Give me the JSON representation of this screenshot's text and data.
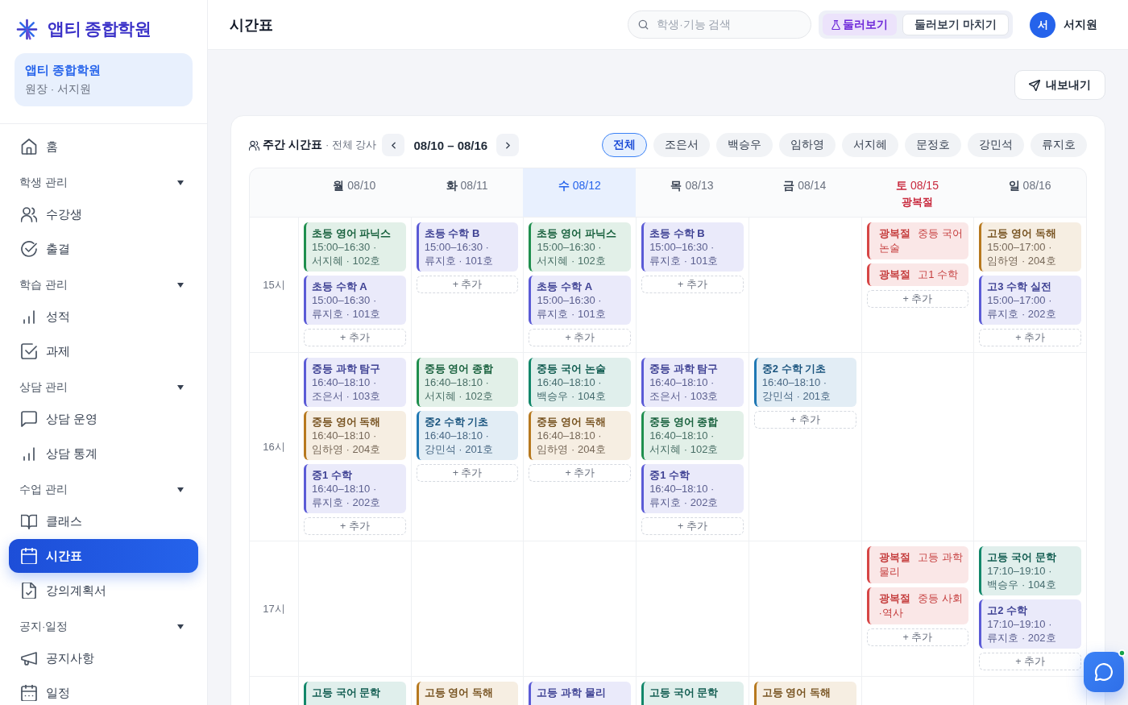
{
  "brand": {
    "name": "앱티 종합학원"
  },
  "org": {
    "name": "앱티 종합학원",
    "role": "원장 · 서지원"
  },
  "sidebar": {
    "items": [
      {
        "kind": "item",
        "label": "홈",
        "selected": false
      },
      {
        "kind": "group",
        "label": "학생 관리",
        "expanded": true,
        "children": [
          {
            "label": "수강생",
            "selected": false
          },
          {
            "label": "출결",
            "selected": false
          }
        ]
      },
      {
        "kind": "group",
        "label": "학습 관리",
        "expanded": true,
        "children": [
          {
            "label": "성적",
            "selected": false
          },
          {
            "label": "과제",
            "selected": false
          }
        ]
      },
      {
        "kind": "group",
        "label": "상담 관리",
        "expanded": true,
        "children": [
          {
            "label": "상담 운영",
            "selected": false
          },
          {
            "label": "상담 통계",
            "selected": false
          }
        ]
      },
      {
        "kind": "group",
        "label": "수업 관리",
        "expanded": true,
        "children": [
          {
            "label": "클래스",
            "selected": false
          },
          {
            "label": "시간표",
            "selected": true
          },
          {
            "label": "강의계획서",
            "selected": false
          }
        ]
      },
      {
        "kind": "group",
        "label": "공지·일정",
        "expanded": true,
        "children": [
          {
            "label": "공지사항",
            "selected": false
          },
          {
            "label": "일정",
            "selected": false
          }
        ]
      }
    ]
  },
  "topbar": {
    "title": "시간표",
    "search": {
      "placeholder": "학생·기능 검색"
    },
    "tour_button": "둘러보기",
    "tour_end_button": "둘러보기 마치기",
    "user": {
      "initial": "서",
      "name": "서지원"
    }
  },
  "export_button": "내보내기",
  "timetable": {
    "title": "주간 시간표",
    "scope": "· 전체 강사",
    "range": "08/10 – 08/16",
    "filters": [
      {
        "label": "전체",
        "selected": true
      },
      {
        "label": "조은서",
        "selected": false
      },
      {
        "label": "백승우",
        "selected": false
      },
      {
        "label": "임하영",
        "selected": false
      },
      {
        "label": "서지혜",
        "selected": false
      },
      {
        "label": "문정호",
        "selected": false
      },
      {
        "label": "강민석",
        "selected": false
      },
      {
        "label": "류지호",
        "selected": false
      }
    ],
    "days": [
      {
        "weekday": "월",
        "date": "08/10",
        "today": false
      },
      {
        "weekday": "화",
        "date": "08/11",
        "today": false
      },
      {
        "weekday": "수",
        "date": "08/12",
        "today": true
      },
      {
        "weekday": "목",
        "date": "08/13",
        "today": false
      },
      {
        "weekday": "금",
        "date": "08/14",
        "today": false
      },
      {
        "weekday": "토",
        "date": "08/15",
        "today": false,
        "holiday": "광복절"
      },
      {
        "weekday": "일",
        "date": "08/16",
        "today": false
      }
    ],
    "rows": [
      {
        "time": "15시",
        "cells": [
          {
            "events": [
              {
                "kind": "class",
                "title": "초등 영어 파닉스",
                "detail": "15:00–16:30 · 서지혜 · 102호",
                "color": "#1f8f4e"
              },
              {
                "kind": "class",
                "title": "초등 수학 A",
                "detail": "15:00–16:30 · 류지호 · 101호",
                "color": "#5b5bd6"
              }
            ],
            "add": "+ 추가"
          },
          {
            "events": [
              {
                "kind": "class",
                "title": "초등 수학 B",
                "detail": "15:00–16:30 · 류지호 · 101호",
                "color": "#5b5bd6"
              }
            ],
            "add": "+ 추가"
          },
          {
            "events": [
              {
                "kind": "class",
                "title": "초등 영어 파닉스",
                "detail": "15:00–16:30 · 서지혜 · 102호",
                "color": "#1f8f4e"
              },
              {
                "kind": "class",
                "title": "초등 수학 A",
                "detail": "15:00–16:30 · 류지호 · 101호",
                "color": "#5b5bd6"
              }
            ],
            "add": "+ 추가"
          },
          {
            "events": [
              {
                "kind": "class",
                "title": "초등 수학 B",
                "detail": "15:00–16:30 · 류지호 · 101호",
                "color": "#5b5bd6"
              }
            ],
            "add": "+ 추가"
          },
          {},
          {
            "events": [
              {
                "kind": "holiday",
                "tag": "광복절",
                "title": "중등 국어 논술",
                "color": "#d64545"
              },
              {
                "kind": "holiday",
                "tag": "광복절",
                "title": "고1 수학",
                "color": "#d64545"
              }
            ],
            "add": "+ 추가"
          },
          {
            "events": [
              {
                "kind": "class",
                "title": "고등 영어 독해",
                "detail": "15:00–17:00 · 임하영 · 204호",
                "color": "#b7791f"
              },
              {
                "kind": "class",
                "title": "고3 수학 실전",
                "detail": "15:00–17:00 · 류지호 · 202호",
                "color": "#5b5bd6"
              }
            ],
            "add": "+ 추가"
          }
        ]
      },
      {
        "time": "16시",
        "cells": [
          {
            "events": [
              {
                "kind": "class",
                "title": "중등 과학 탐구",
                "detail": "16:40–18:10 · 조은서 · 103호",
                "color": "#5b5bd6"
              },
              {
                "kind": "class",
                "title": "중등 영어 독해",
                "detail": "16:40–18:10 · 임하영 · 204호",
                "color": "#b7791f"
              },
              {
                "kind": "class",
                "title": "중1 수학",
                "detail": "16:40–18:10 · 류지호 · 202호",
                "color": "#5b5bd6"
              }
            ],
            "add": "+ 추가"
          },
          {
            "events": [
              {
                "kind": "class",
                "title": "중등 영어 종합",
                "detail": "16:40–18:10 · 서지혜 · 102호",
                "color": "#1f8f4e"
              },
              {
                "kind": "class",
                "title": "중2 수학 기초",
                "detail": "16:40–18:10 · 강민석 · 201호",
                "color": "#1f78b4"
              }
            ],
            "add": "+ 추가"
          },
          {
            "events": [
              {
                "kind": "class",
                "title": "중등 국어 논술",
                "detail": "16:40–18:10 · 백승우 · 104호",
                "color": "#12876a"
              },
              {
                "kind": "class",
                "title": "중등 영어 독해",
                "detail": "16:40–18:10 · 임하영 · 204호",
                "color": "#b7791f"
              }
            ],
            "add": "+ 추가"
          },
          {
            "events": [
              {
                "kind": "class",
                "title": "중등 과학 탐구",
                "detail": "16:40–18:10 · 조은서 · 103호",
                "color": "#5b5bd6"
              },
              {
                "kind": "class",
                "title": "중등 영어 종합",
                "detail": "16:40–18:10 · 서지혜 · 102호",
                "color": "#1f8f4e"
              },
              {
                "kind": "class",
                "title": "중1 수학",
                "detail": "16:40–18:10 · 류지호 · 202호",
                "color": "#5b5bd6"
              }
            ],
            "add": "+ 추가"
          },
          {
            "events": [
              {
                "kind": "class",
                "title": "중2 수학 기초",
                "detail": "16:40–18:10 · 강민석 · 201호",
                "color": "#1f78b4"
              }
            ],
            "add": "+ 추가"
          },
          {},
          {}
        ]
      },
      {
        "time": "17시",
        "cells": [
          {},
          {},
          {},
          {},
          {},
          {
            "events": [
              {
                "kind": "holiday",
                "tag": "광복절",
                "title": "고등 과학 물리",
                "color": "#d64545"
              },
              {
                "kind": "holiday",
                "tag": "광복절",
                "title": "중등 사회·역사",
                "color": "#d64545"
              }
            ],
            "add": "+ 추가"
          },
          {
            "events": [
              {
                "kind": "class",
                "title": "고등 국어 문학",
                "detail": "17:10–19:10 · 백승우 · 104호",
                "color": "#12876a"
              },
              {
                "kind": "class",
                "title": "고2 수학",
                "detail": "17:10–19:10 · 류지호 · 202호",
                "color": "#5b5bd6"
              }
            ],
            "add": "+ 추가"
          }
        ]
      },
      {
        "cells": [
          {
            "events": [
              {
                "kind": "class",
                "title": "고등 국어 문학",
                "color": "#12876a"
              }
            ]
          },
          {
            "events": [
              {
                "kind": "class",
                "title": "고등 영어 독해",
                "color": "#b7791f"
              }
            ]
          },
          {
            "events": [
              {
                "kind": "class",
                "title": "고등 과학 물리",
                "color": "#5b5bd6"
              }
            ]
          },
          {
            "events": [
              {
                "kind": "class",
                "title": "고등 국어 문학",
                "color": "#12876a"
              }
            ]
          },
          {
            "events": [
              {
                "kind": "class",
                "title": "고등 영어 독해",
                "color": "#b7791f"
              }
            ]
          },
          {},
          {}
        ]
      }
    ]
  },
  "chat": {
    "online": true
  }
}
